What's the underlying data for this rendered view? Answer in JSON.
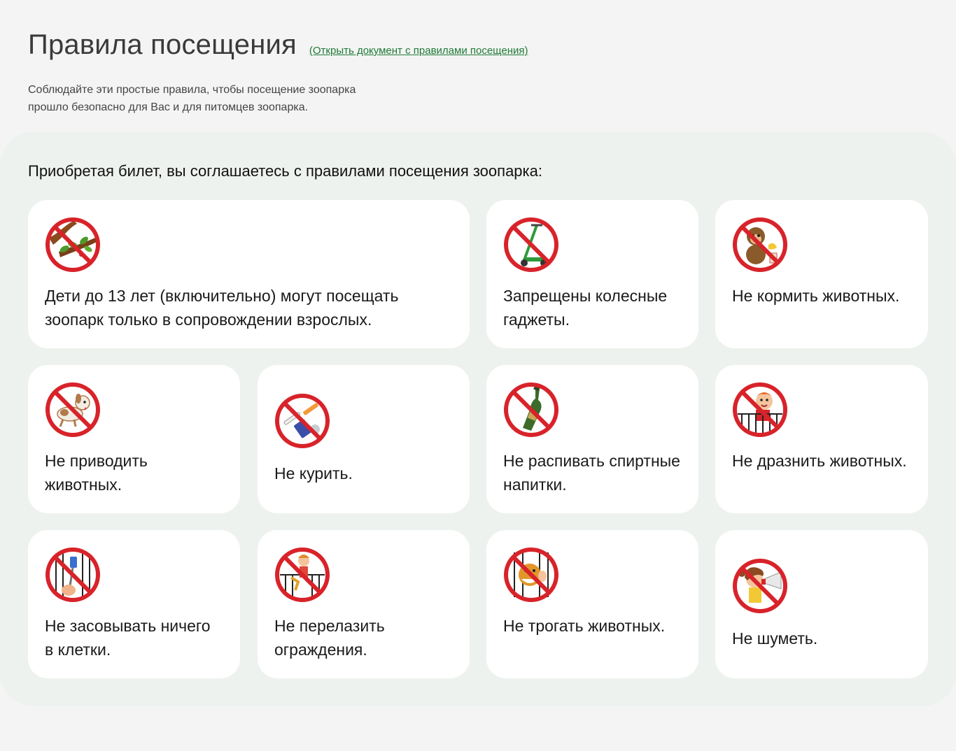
{
  "header": {
    "title": "Правила посещения",
    "doc_link": "(Открыть документ с правилами посещения)"
  },
  "intro": {
    "line1": "Соблюдайте эти простые правила, чтобы посещение зоопарка",
    "line2": "прошло безопасно для Вас и для питомцев зоопарка."
  },
  "panel": {
    "heading": "Приобретая билет, вы соглашаетесь с правилами посещения зоопарка:"
  },
  "rules": [
    {
      "icon": "no-climbing-trees-icon",
      "text": "Дети до 13 лет (включительно) могут посещать зоопарк только в сопровождении взрослых."
    },
    {
      "icon": "no-scooter-icon",
      "text": "Запрещены колесные гаджеты."
    },
    {
      "icon": "no-feeding-monkey-icon",
      "text": "Не кормить животных."
    },
    {
      "icon": "no-pets-dog-icon",
      "text": "Не приводить животных."
    },
    {
      "icon": "no-smoking-icon",
      "text": "Не курить."
    },
    {
      "icon": "no-alcohol-bottle-icon",
      "text": "Не распивать спиртные напитки."
    },
    {
      "icon": "no-teasing-animals-icon",
      "text": "Не дразнить животных."
    },
    {
      "icon": "no-objects-in-cage-icon",
      "text": "Не засовывать ничего в клетки."
    },
    {
      "icon": "no-fence-climbing-icon",
      "text": "Не перелазить ограждения."
    },
    {
      "icon": "no-touching-animals-icon",
      "text": "Не трогать животных."
    },
    {
      "icon": "no-noise-megaphone-icon",
      "text": "Не шуметь."
    }
  ],
  "colors": {
    "prohibition_red": "#d8232a",
    "link_green": "#1e7a35",
    "panel_bg": "#eef2ee"
  }
}
